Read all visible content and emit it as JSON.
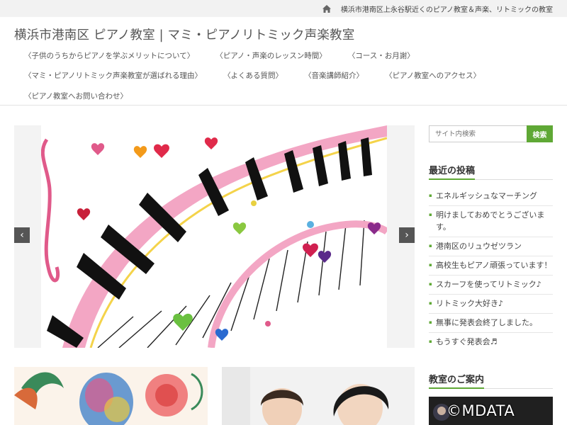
{
  "topbar": {
    "tagline": "横浜市港南区上永谷駅近くのピアノ教室＆声楽、リトミックの教室",
    "home_icon": "home-icon"
  },
  "site": {
    "title": "横浜市港南区 ピアノ教室 | マミ・ピアノリトミック声楽教室"
  },
  "nav": {
    "row1": [
      "〈子供のうちからピアノを学ぶメリットについて〉",
      "〈ピアノ・声楽のレッスン時間〉",
      "〈コース・お月謝〉"
    ],
    "row2": [
      "〈マミ・ピアノリトミック声楽教室が選ばれる理由〉",
      "〈よくある質問〉",
      "〈音楽講師紹介〉",
      "〈ピアノ教室へのアクセス〉"
    ],
    "row3": [
      "〈ピアノ教室へお問い合わせ〉"
    ]
  },
  "slider": {
    "prev_icon": "chevron-left-icon",
    "next_icon": "chevron-right-icon",
    "prev_glyph": "‹",
    "next_glyph": "›"
  },
  "search": {
    "placeholder": "サイト内検索",
    "button_label": "検索"
  },
  "recent_posts": {
    "title": "最近の投稿",
    "items": [
      "エネルギッシュなマーチング",
      "明けましておめでとうございます。",
      "港南区のリュウゼツラン",
      "高校生もピアノ頑張っています！",
      "スカーフを使ってリトミック♪",
      "リトミック大好き♪",
      "無事に発表会終了しました。",
      "もうすぐ発表会♬"
    ]
  },
  "guide": {
    "title": "教室のご案内"
  },
  "watermark": "©MDATA",
  "colors": {
    "accent": "#5fa835",
    "topbar_bg": "#f2f2f2"
  }
}
